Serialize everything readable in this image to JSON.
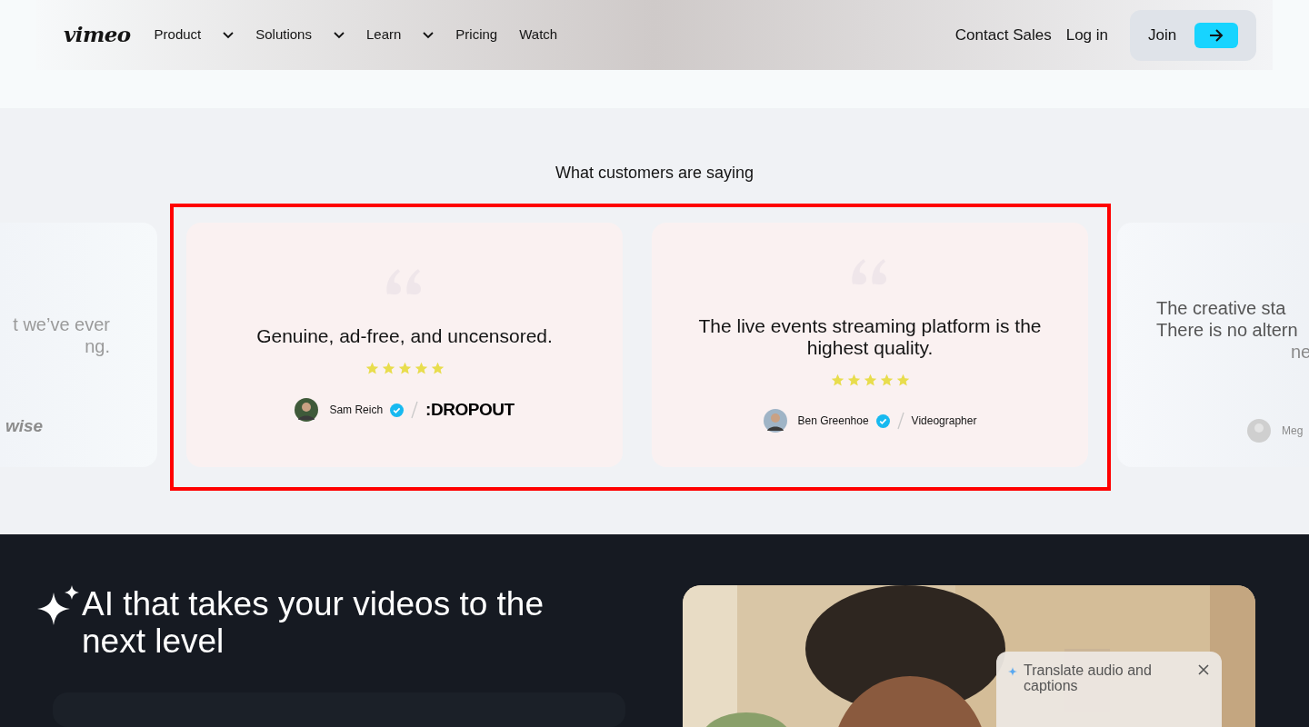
{
  "nav": {
    "logo": "vimeo",
    "items": [
      {
        "label": "Product",
        "dropdown": true
      },
      {
        "label": "Solutions",
        "dropdown": true
      },
      {
        "label": "Learn",
        "dropdown": true
      },
      {
        "label": "Pricing",
        "dropdown": false
      },
      {
        "label": "Watch",
        "dropdown": false
      }
    ],
    "links": [
      "Contact Sales",
      "Log in"
    ],
    "join": "Join"
  },
  "testimonials": {
    "title": "What customers are saying",
    "cards": [
      {
        "kind": "partial-left",
        "lines": [
          "t we’ve ever",
          "ng."
        ],
        "brand": "wise"
      },
      {
        "kind": "full",
        "quote": "Genuine, ad-free, and uncensored.",
        "stars": 5,
        "author": "Sam Reich",
        "verified": true,
        "affiliation": ":DROPOUT",
        "affiliation_is_logo": true
      },
      {
        "kind": "full",
        "quote": "The live events streaming platform is the highest quality.",
        "stars": 5,
        "author": "Ben Greenhoe",
        "verified": true,
        "affiliation": "Videographer",
        "affiliation_is_logo": false
      },
      {
        "kind": "partial-right",
        "lines": [
          "The creative sta",
          "There is no altern",
          "ne"
        ],
        "author": "Meg"
      }
    ]
  },
  "ai": {
    "title": "AI that takes your videos to the next level",
    "panel": {
      "title": "Translate audio and captions"
    }
  }
}
